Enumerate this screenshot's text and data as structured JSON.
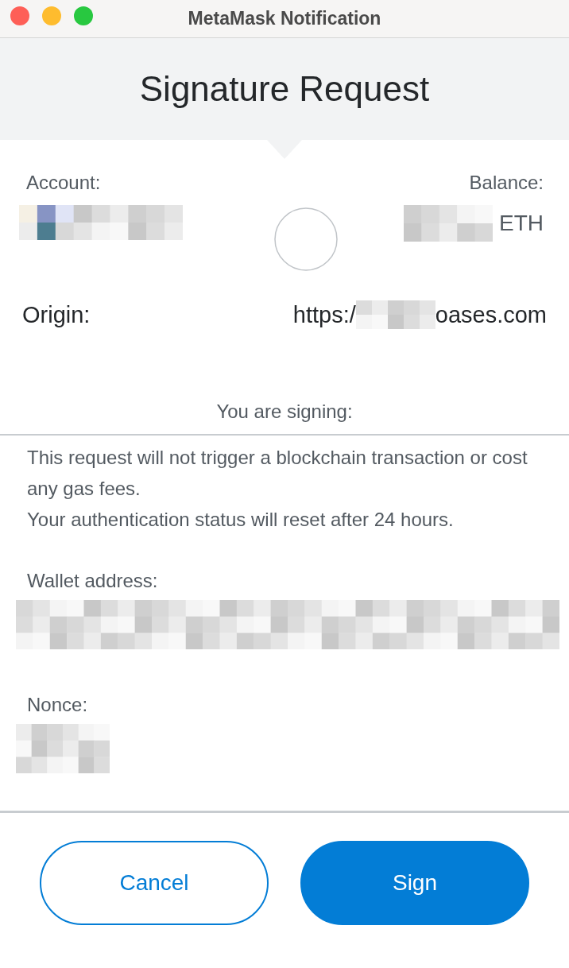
{
  "window": {
    "title": "MetaMask Notification"
  },
  "header": {
    "title": "Signature Request"
  },
  "account": {
    "label": "Account:"
  },
  "balance": {
    "label": "Balance:",
    "unit": "ETH"
  },
  "origin": {
    "label": "Origin:",
    "prefix": "https:/",
    "suffix": "oases.com"
  },
  "signing_label": "You are signing:",
  "message": {
    "paragraphs": [
      "This request will not trigger a blockchain transaction or cost any gas fees.",
      "Your authentication status will reset after 24 hours."
    ],
    "fields": [
      {
        "label": "Wallet address:",
        "kind": "long"
      },
      {
        "label": "Nonce:",
        "kind": "short"
      }
    ]
  },
  "buttons": [
    {
      "label": "Cancel",
      "kind": "secondary"
    },
    {
      "label": "Sign",
      "kind": "primary"
    }
  ]
}
